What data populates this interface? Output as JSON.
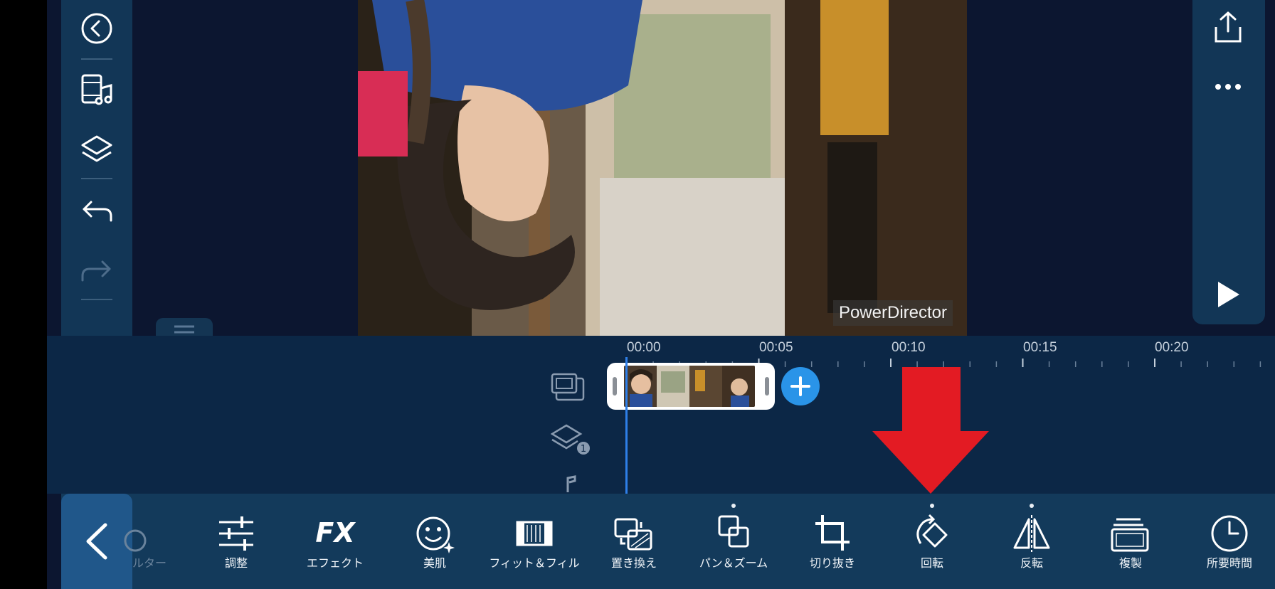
{
  "preview": {
    "watermark": "PowerDirector"
  },
  "timeline": {
    "ticks": [
      "00:00",
      "00:05",
      "00:10",
      "00:15",
      "00:20"
    ],
    "layer_badge": "1"
  },
  "toolbar": {
    "partial_label": "ルター",
    "tools": [
      {
        "label": "調整",
        "icon": "adjust-sliders-icon"
      },
      {
        "label": "エフェクト",
        "icon": "fx-icon",
        "glyph": "FX"
      },
      {
        "label": "美肌",
        "icon": "skin-smile-icon"
      },
      {
        "label": "フィット＆フィル",
        "icon": "fit-fill-icon"
      },
      {
        "label": "置き換え",
        "icon": "replace-icon"
      },
      {
        "label": "パン＆ズーム",
        "icon": "pan-zoom-icon"
      },
      {
        "label": "切り抜き",
        "icon": "crop-icon"
      },
      {
        "label": "回転",
        "icon": "rotate-icon"
      },
      {
        "label": "反転",
        "icon": "flip-icon"
      },
      {
        "label": "複製",
        "icon": "duplicate-icon"
      },
      {
        "label": "所要時間",
        "icon": "duration-clock-icon"
      }
    ]
  },
  "colors": {
    "accent": "#2a94e8",
    "annotation_arrow": "#e31b23",
    "panel": "#123656",
    "background": "#0c1630"
  }
}
